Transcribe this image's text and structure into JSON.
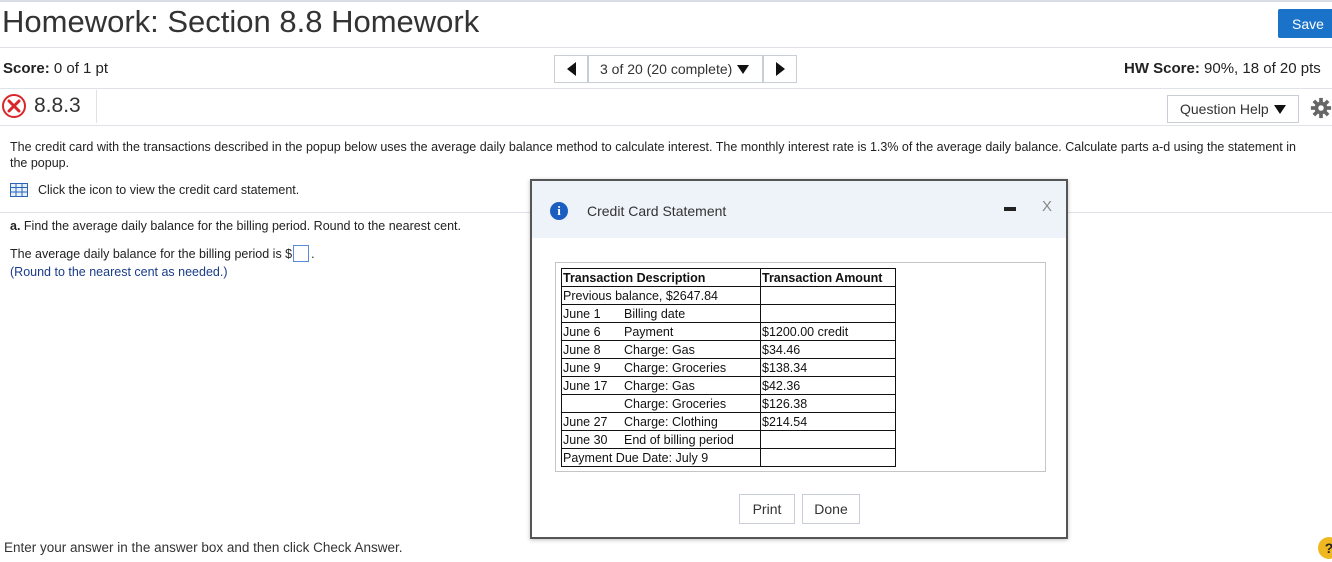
{
  "header": {
    "title": "Homework: Section 8.8 Homework",
    "save_label": "Save"
  },
  "scorebar": {
    "score_label": "Score:",
    "score_value": " 0 of 1 pt",
    "nav_text": "3 of 20 (20 complete)",
    "hw_score_label": "HW Score:",
    "hw_score_value": " 90%, 18 of 20 pts"
  },
  "question": {
    "number": "8.8.3",
    "help_label": "Question Help",
    "text": "The credit card with the transactions described in the popup below uses the average daily balance method to calculate interest.  The monthly interest rate is 1.3% of the average daily balance.  Calculate parts a-d using the statement in the popup.",
    "click_icon_text": "Click the icon to view the credit card statement.",
    "part_a_label": "a.",
    "part_a_text": " Find the average daily balance for the billing period.  Round to the nearest cent.",
    "answer_prefix": "The average daily balance for the billing period is $",
    "answer_suffix": ".",
    "answer_value": "",
    "round_note": "(Round to the nearest cent as needed.)"
  },
  "footer": {
    "instruction": "Enter your answer in the answer box and then click Check Answer.",
    "help_symbol": "?"
  },
  "popup": {
    "title": "Credit Card Statement",
    "close_symbol": "X",
    "print_label": "Print",
    "done_label": "Done",
    "table": {
      "headers": [
        "Transaction Description",
        "Transaction Amount"
      ],
      "rows": [
        {
          "date": "",
          "desc": "Previous balance, $2647.84",
          "amount": ""
        },
        {
          "date": "June 1",
          "desc": "Billing date",
          "amount": ""
        },
        {
          "date": "June 6",
          "desc": "Payment",
          "amount": "$1200.00 credit"
        },
        {
          "date": "June 8",
          "desc": "Charge: Gas",
          "amount": "$34.46"
        },
        {
          "date": "June 9",
          "desc": "Charge: Groceries",
          "amount": "$138.34"
        },
        {
          "date": "June 17",
          "desc": "Charge: Gas",
          "amount": "$42.36"
        },
        {
          "date": "",
          "desc": "Charge: Groceries",
          "amount": "$126.38"
        },
        {
          "date": "June 27",
          "desc": "Charge: Clothing",
          "amount": "$214.54"
        },
        {
          "date": "June 30",
          "desc": "End of billing period",
          "amount": ""
        },
        {
          "date": "",
          "desc": "Payment Due Date: July 9",
          "amount": ""
        }
      ]
    }
  },
  "colors": {
    "save_button": "#1a73c9",
    "incorrect_mark": "#d9262a",
    "info_icon": "#1a5fc0",
    "help_circle": "#f0b820",
    "popup_header": "#eef3fa"
  },
  "icons": [
    "incorrect-x-icon",
    "gear-icon",
    "grid-table-icon",
    "info-icon",
    "minimize-icon",
    "close-icon",
    "prev-arrow-icon",
    "next-arrow-icon",
    "dropdown-caret-icon",
    "help-icon"
  ]
}
